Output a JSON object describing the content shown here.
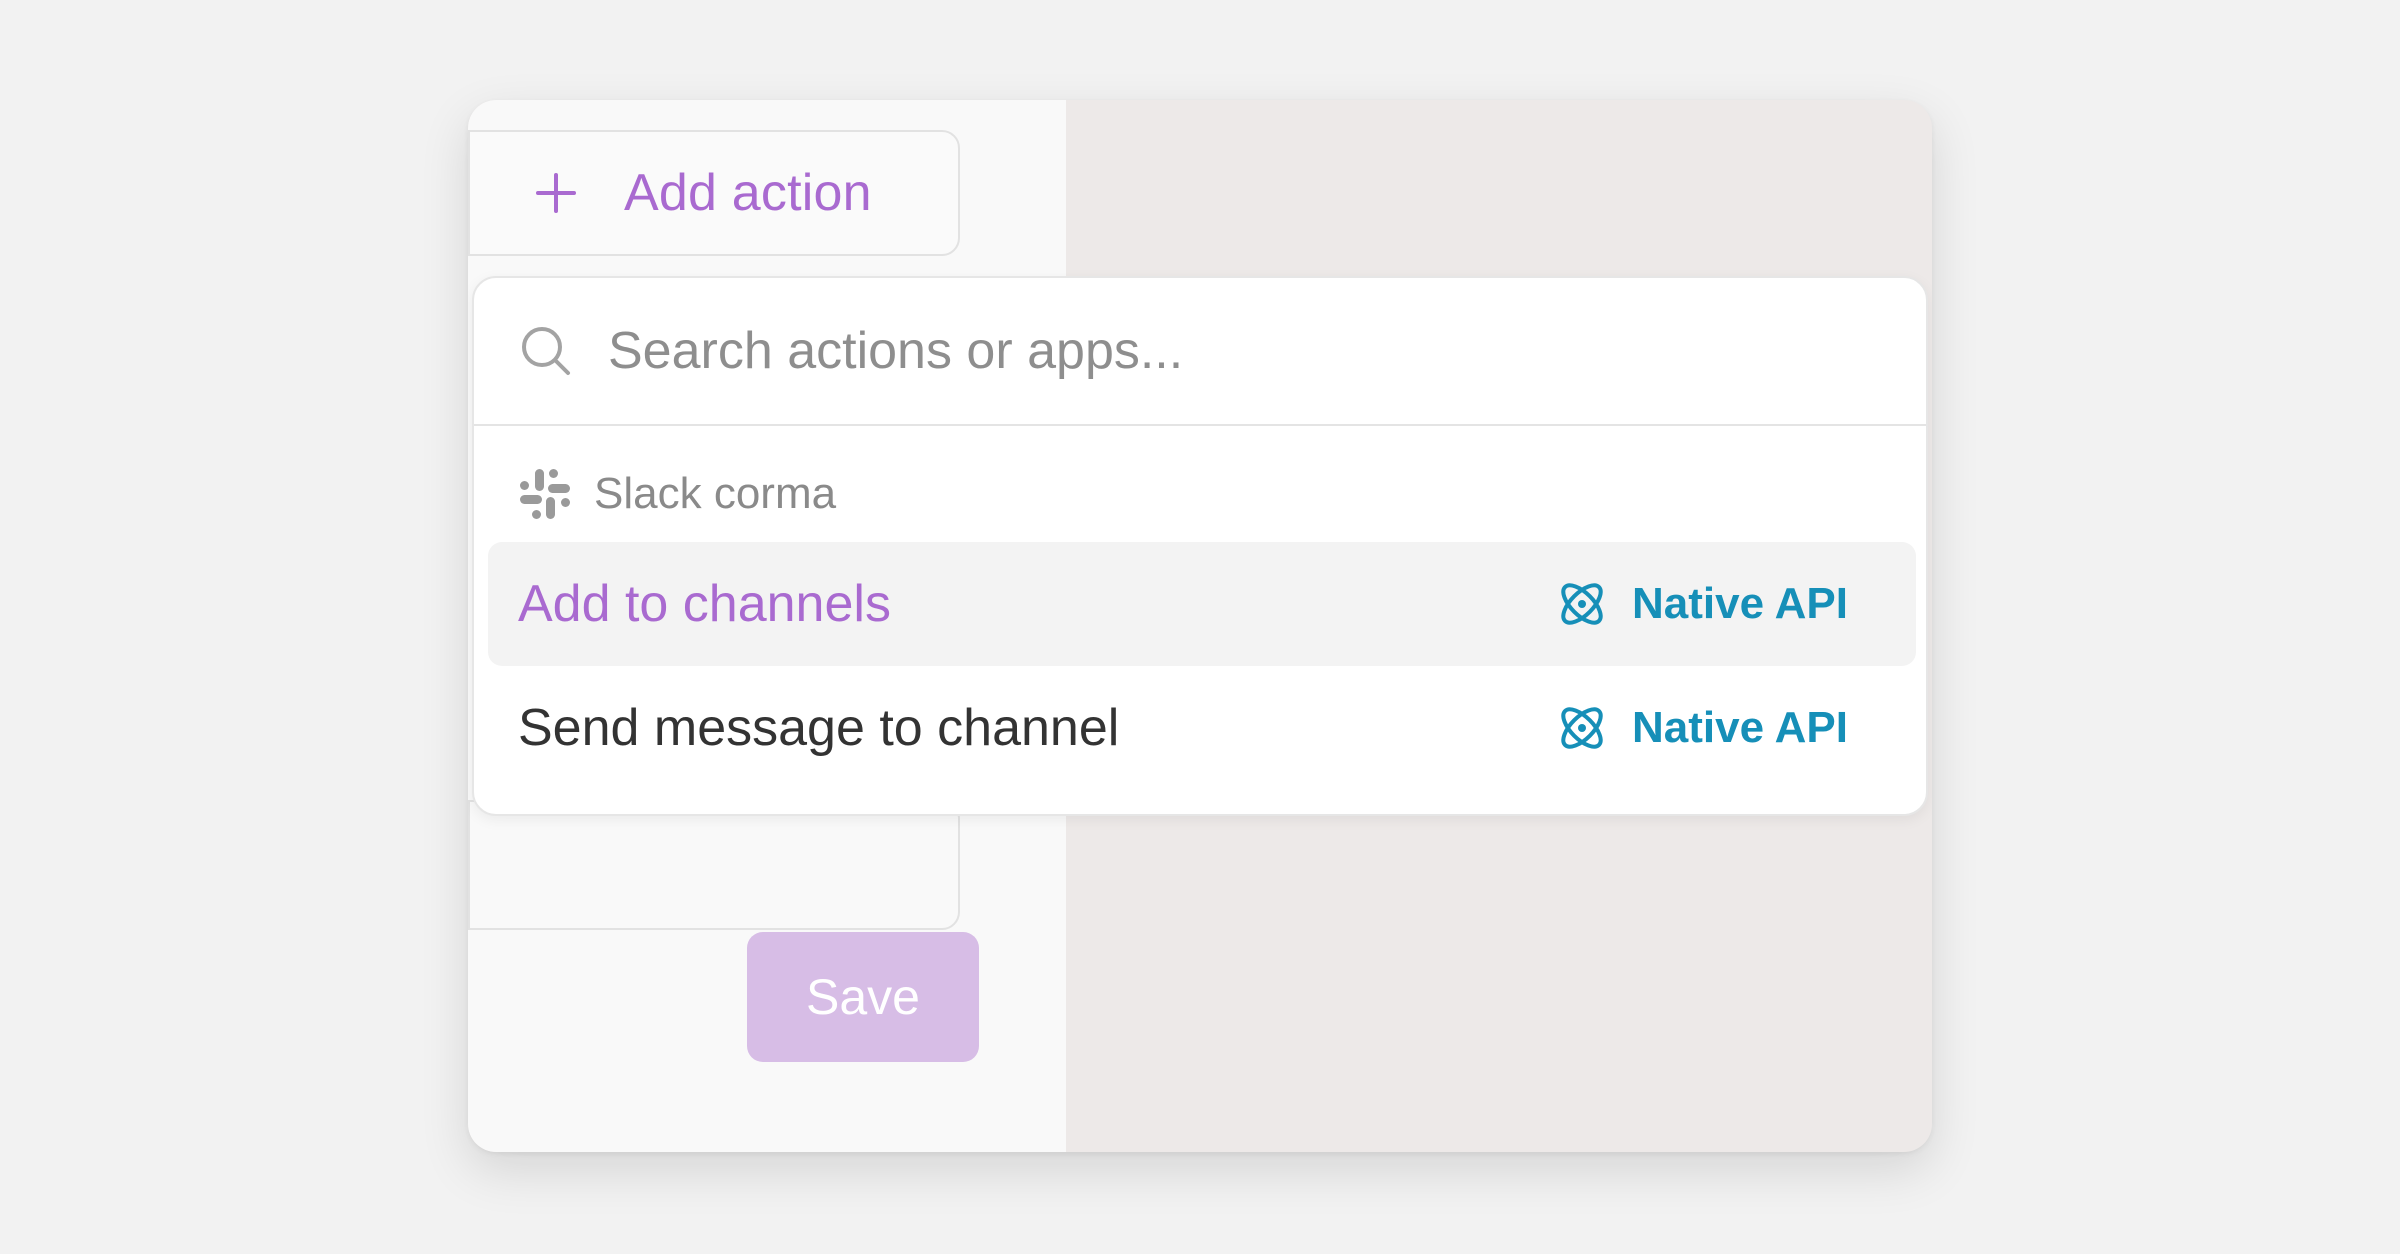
{
  "colors": {
    "accent": "#a96ad0",
    "save_button": "#d7bde6",
    "badge": "#168fb8",
    "text_primary": "#333333",
    "text_muted": "#8a8a8a",
    "page_background": "#f2f2f2",
    "canvas_background": "#ede9e8"
  },
  "left_panel": {
    "add_action": {
      "icon": "plus-icon",
      "label": "Add action"
    },
    "save_label": "Save"
  },
  "dropdown": {
    "search": {
      "icon": "search-icon",
      "placeholder": "Search actions or apps...",
      "value": ""
    },
    "group": {
      "icon": "slack-icon",
      "label": "Slack corma"
    },
    "actions": [
      {
        "label": "Add to channels",
        "badge": "Native API",
        "badge_icon": "atom-icon",
        "highlighted": true
      },
      {
        "label": "Send message to channel",
        "badge": "Native API",
        "badge_icon": "atom-icon",
        "highlighted": false
      }
    ]
  }
}
